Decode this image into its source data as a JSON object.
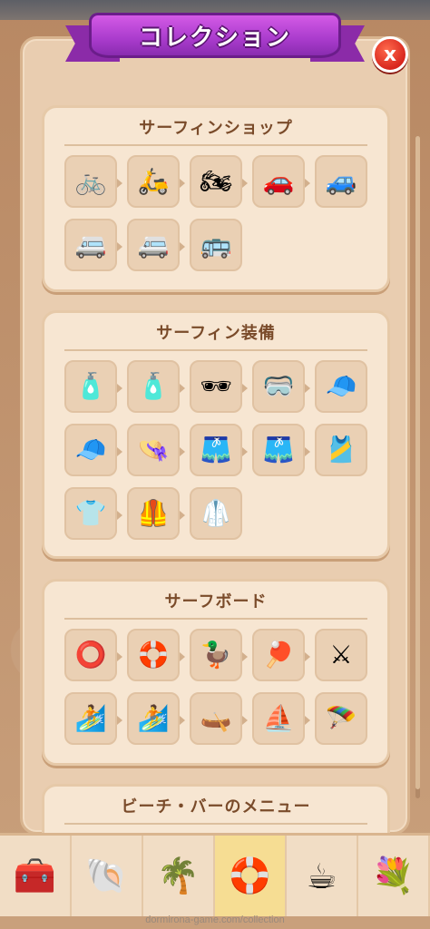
{
  "header": {
    "title": "コレクション",
    "close_label": "x"
  },
  "sections": [
    {
      "title": "サーフィンショップ",
      "items": [
        "bicycle-surfboard-icon",
        "scooter-surfboard-icon",
        "sidecar-surfboard-icon",
        "car-surfboard-icon",
        "jeep-surfboard-icon",
        "van-surfboard-icon",
        "minibus-surfboard-icon",
        "camper-van-surfboard-icon"
      ],
      "glyphs": [
        "🚲",
        "🛵",
        "🏍",
        "🚗",
        "🚙",
        "🚐",
        "🚐",
        "🚌"
      ]
    },
    {
      "title": "サーフィン装備",
      "items": [
        "sunscreen-tube-icon",
        "sunscreen-bottle-icon",
        "sunglasses-icon",
        "sport-glasses-icon",
        "visor-icon",
        "cap-icon",
        "bucket-hat-icon",
        "swim-trunks-icon",
        "board-shorts-icon",
        "tank-top-icon",
        "t-shirt-icon",
        "vest-wetsuit-icon",
        "wetsuit-icon"
      ],
      "glyphs": [
        "🧴",
        "🧴",
        "🕶",
        "🥽",
        "🧢",
        "🧢",
        "👒",
        "🩳",
        "🩳",
        "🎽",
        "👕",
        "🦺",
        "🥼"
      ]
    },
    {
      "title": "サーフボード",
      "items": [
        "swim-ring-icon",
        "life-ring-icon",
        "duck-float-icon",
        "paddle-icon",
        "crossed-paddles-icon",
        "surfboard-icon",
        "shortboard-icon",
        "kayak-icon",
        "windsurf-icon",
        "kitesurf-icon"
      ],
      "glyphs": [
        "⭕",
        "🛟",
        "🦆",
        "🏓",
        "⚔",
        "🏄",
        "🏄",
        "🛶",
        "⛵",
        "🪂"
      ]
    },
    {
      "title": "ビーチ・バーのメニュー",
      "items": [],
      "glyphs": []
    }
  ],
  "bottom_nav": [
    {
      "name": "treasure-chest-icon",
      "glyph": "🧰",
      "active": false
    },
    {
      "name": "seashell-icon",
      "glyph": "🐚",
      "active": false
    },
    {
      "name": "palm-tree-icon",
      "glyph": "🌴",
      "active": false
    },
    {
      "name": "life-buoy-icon",
      "glyph": "🛟",
      "active": true
    },
    {
      "name": "coffee-cup-icon",
      "glyph": "☕",
      "active": false
    },
    {
      "name": "flower-bouquet-icon",
      "glyph": "💐",
      "active": false
    }
  ],
  "footer": "dormirona-game.com/collection",
  "colors": {
    "banner": "#a93bcc",
    "close": "#d8261d",
    "section_bg": "#f7e6d2",
    "title_text": "#7a4b2a",
    "active_tab": "#f6dd93"
  }
}
